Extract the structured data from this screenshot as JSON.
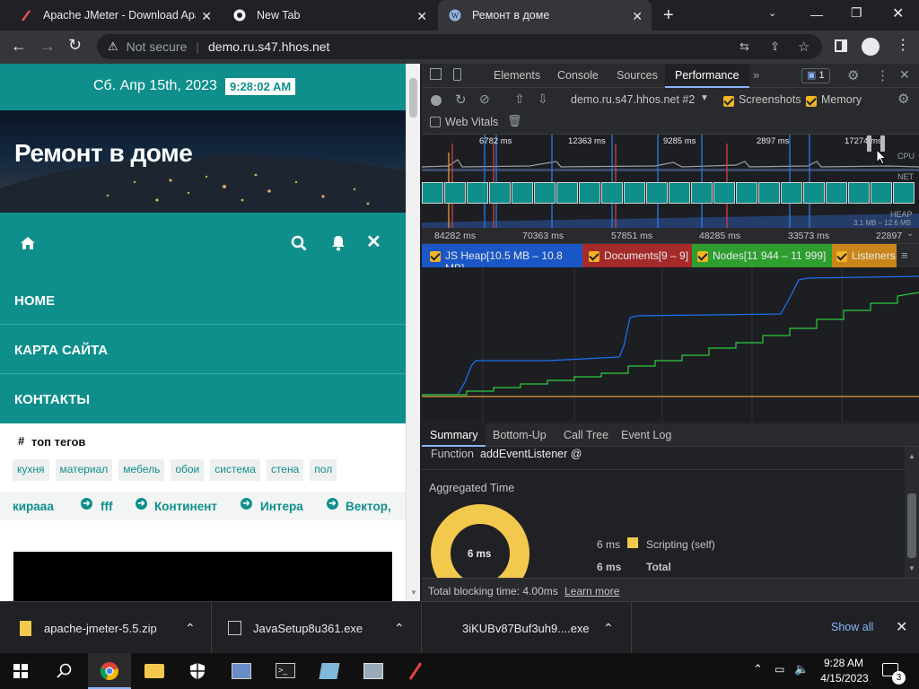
{
  "browser": {
    "tabs": [
      {
        "title": "Apache JMeter - Download Apac",
        "active": false
      },
      {
        "title": "New Tab",
        "active": false
      },
      {
        "title": "Ремонт в доме",
        "active": true
      }
    ],
    "security_label": "Not secure",
    "url": "demo.ru.s47.hhos.net"
  },
  "site": {
    "date": "Сб. Апр 15th, 2023",
    "time": "9:28:02 AM",
    "title": "Ремонт в доме",
    "menu": [
      "HOME",
      "КАРТА САЙТА",
      "КОНТАКТЫ"
    ],
    "tags_heading": "топ тегов",
    "tags": [
      "кухня",
      "материал",
      "мебель",
      "обои",
      "система",
      "стена",
      "пол"
    ],
    "ticker": [
      "кирааа",
      "fff",
      "Континент",
      "Интера",
      "Вектор,"
    ],
    "accent": "#0e8f8c"
  },
  "devtools": {
    "tabs": [
      "Elements",
      "Console",
      "Sources",
      "Performance"
    ],
    "active_tab": "Performance",
    "issues_count": "1",
    "recording": "demo.ru.s47.hhos.net #2",
    "screenshots_label": "Screenshots",
    "memory_label": "Memory",
    "web_vitals_label": "Web Vitals",
    "overview_labels": [
      "6782 ms",
      "12363 ms",
      "9285 ms",
      "2897 ms",
      "17274 ms"
    ],
    "track_labels": {
      "cpu": "CPU",
      "net": "NET",
      "heap": "HEAP",
      "heap_range": "3.1 MB – 12.6 MB"
    },
    "ruler": [
      "84282 ms",
      "70363 ms",
      "57851 ms",
      "48285 ms",
      "33573 ms",
      "22897"
    ],
    "counters": [
      {
        "label": "JS Heap[10.5 MB – 10.8 MB]",
        "color": "#1a56c6"
      },
      {
        "label": "Documents[9 – 9]",
        "color": "#a52a2a"
      },
      {
        "label": "Nodes[11 944 – 11 999]",
        "color": "#2e9e2e"
      },
      {
        "label": "Listeners",
        "color": "#c8861a"
      }
    ],
    "bottom_tabs": [
      "Summary",
      "Bottom-Up",
      "Call Tree",
      "Event Log"
    ],
    "function_label": "Function",
    "function_value": "addEventListener @",
    "aggregated_title": "Aggregated Time",
    "donut_label": "6 ms",
    "legend": [
      {
        "value": "6 ms",
        "label": "Scripting (self)",
        "color": "#f2c94c"
      },
      {
        "value": "6 ms",
        "label": "Total"
      }
    ],
    "tbt_label": "Total blocking time: 4.00ms",
    "learn_more": "Learn more"
  },
  "downloads": {
    "items": [
      "apache-jmeter-5.5.zip",
      "JavaSetup8u361.exe",
      "3iKUBv87Buf3uh9....exe"
    ],
    "show_all": "Show all"
  },
  "taskbar": {
    "time": "9:28 AM",
    "date": "4/15/2023",
    "notifications": "3"
  }
}
